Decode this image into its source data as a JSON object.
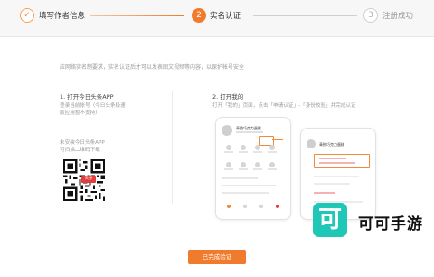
{
  "steps": [
    {
      "label": "填写作者信息",
      "state": "done",
      "icon": "check-icon"
    },
    {
      "number": "2",
      "label": "实名认证",
      "state": "active"
    },
    {
      "number": "3",
      "label": "注册成功",
      "state": "pending"
    }
  ],
  "intro": "应网络实名制要求，实名认证后才可以发表图文视频等内容，以保护帐号安全",
  "left": {
    "title": "1. 打开今日头条APP",
    "desc": [
      "登录当前帐号（今日头条极速",
      "版应用暂不支持）"
    ],
    "qr_hint": [
      "未安装今日头条APP",
      "可扫描二维码下载"
    ],
    "qr_badge": "头条"
  },
  "right": {
    "title": "2. 打开我的",
    "desc": "打开「我的」页面，点击「申请认证」-「身份校验」并完成认证",
    "phone1_name": "青橙巧克力蛋糕",
    "phone2_name": "青橙巧克力蛋糕"
  },
  "watermark": {
    "logo": "可",
    "text": "可可手游"
  },
  "button": {
    "label": "已完成验证"
  },
  "colors": {
    "accent": "#f07b2c",
    "watermark": "#1fc7b6"
  }
}
